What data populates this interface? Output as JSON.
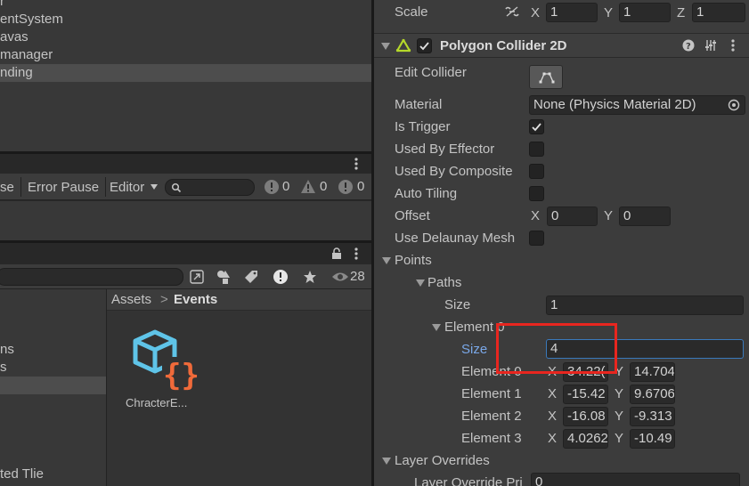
{
  "hierarchy": {
    "items": [
      "r",
      "entSystem",
      "avas",
      "manager",
      "nding"
    ]
  },
  "console": {
    "btn_partial": "se",
    "error_pause": "Error Pause",
    "editor_dropdown": "Editor",
    "search_placeholder": "",
    "log_count": "0",
    "warning_count": "0",
    "error_count": "0"
  },
  "project": {
    "visible_count": "28",
    "breadcrumb_root": "Assets",
    "breadcrumb_sep": ">",
    "breadcrumb_current": "Events",
    "tree_items": [
      "ns",
      "s",
      "",
      "ted Tlie"
    ],
    "asset_name": "ChracterE..."
  },
  "inspector": {
    "scale_label": "Scale",
    "scale_x_label": "X",
    "scale_x": "1",
    "scale_y_label": "Y",
    "scale_y": "1",
    "scale_z_label": "Z",
    "scale_z": "1",
    "component_title": "Polygon Collider 2D",
    "edit_collider": "Edit Collider",
    "material_label": "Material",
    "material_value": "None (Physics Material 2D)",
    "is_trigger": "Is Trigger",
    "used_by_effector": "Used By Effector",
    "used_by_composite": "Used By Composite",
    "auto_tiling": "Auto Tiling",
    "offset_label": "Offset",
    "offset_x_label": "X",
    "offset_x": "0",
    "offset_y_label": "Y",
    "offset_y": "0",
    "use_delaunay": "Use Delaunay Mesh",
    "points_label": "Points",
    "paths_label": "Paths",
    "paths_size_label": "Size",
    "paths_size": "1",
    "element0_label": "Element 0",
    "element0_size_label": "Size",
    "element0_size": "4",
    "elements": [
      {
        "label": "Element 0",
        "x_label": "X",
        "x": "34.22(",
        "y_label": "Y",
        "y": "14.704"
      },
      {
        "label": "Element 1",
        "x_label": "X",
        "x": "-15.42",
        "y_label": "Y",
        "y": "9.6706"
      },
      {
        "label": "Element 2",
        "x_label": "X",
        "x": "-16.08",
        "y_label": "Y",
        "y": "-9.313"
      },
      {
        "label": "Element 3",
        "x_label": "X",
        "x": "4.0262",
        "y_label": "Y",
        "y": "-10.49"
      }
    ],
    "layer_overrides": "Layer Overrides",
    "layer_override_priority": "Layer Override Pri",
    "layer_override_value": "0"
  },
  "colors": {
    "panel_bg": "#383838",
    "inspector_bg": "#3c3c3c",
    "selected_row": "#4d4d4d",
    "highlight_box": "#e8261f",
    "focus_field": "#3a79bb",
    "active_label": "#7aa8e8",
    "icon_cube": "#5fc4e8",
    "icon_braces": "#f06a3a",
    "collider_icon": "#b5d82a"
  }
}
